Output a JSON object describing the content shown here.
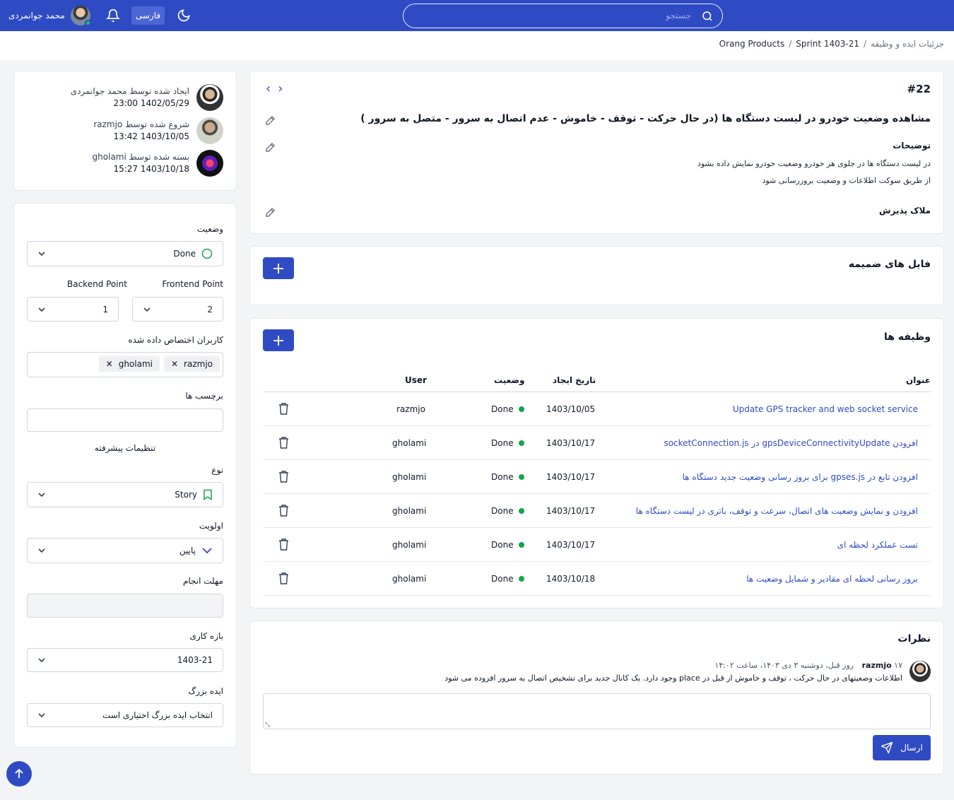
{
  "header": {
    "user_name": "محمد جوانمردی",
    "language_label": "فارسی",
    "search_placeholder": "جستجو"
  },
  "breadcrumb": {
    "items": [
      "Orang Products",
      "Sprint 1403-21",
      "جزئیات ایده و وظیفه"
    ]
  },
  "activity": [
    {
      "label": "ایجاد شده توسط محمد جوانمردی",
      "date": "23:00 1402/05/29"
    },
    {
      "label": "شروع شده توسط razmjo",
      "date": "13:42 1403/10/05"
    },
    {
      "label": "بسته شده توسط gholami",
      "date": "15:27 1403/10/18"
    }
  ],
  "form": {
    "status_label": "وضعیت",
    "status_value": "Done",
    "frontend_label": "Frontend Point",
    "frontend_value": "2",
    "backend_label": "Backend Point",
    "backend_value": "1",
    "assignees_label": "کاربران اختصاص داده شده",
    "assignees": [
      "razmjo",
      "gholami"
    ],
    "tags_label": "برچسب ها",
    "advanced_label": "تنظیمات پیشرفته",
    "type_label": "نوع",
    "type_value": "Story",
    "priority_label": "اولویت",
    "priority_value": "پایین",
    "deadline_label": "مهلت انجام",
    "sprint_label": "بازه کاری",
    "sprint_value": "1403-21",
    "epic_label": "ایده بزرگ",
    "epic_value": "انتخاب ایده بزرگ اختیاری است"
  },
  "task": {
    "number": "#22",
    "title": "مشاهده وضعیت خودرو در لیست دستگاه ها (در حال حرکت - توقف - خاموش - عدم اتصال به سرور - متصل به سرور )",
    "description_label": "توضیحات",
    "description_lines": [
      "در لیست دستگاه ها در جلوی هر خودرو  وضعیت خودرو نمایش داده بشود",
      "از طریق سوکت اطلاعات و وضعیت بروزرسانی شود"
    ],
    "acceptance_label": "ملاک پذیرش"
  },
  "attachments": {
    "title": "فایل های ضمیمه"
  },
  "subtasks": {
    "title": "وظیفه ها",
    "columns": {
      "title": "عنوان",
      "created": "تاریخ ایجاد",
      "status": "وضعیت",
      "user": "User"
    },
    "rows": [
      {
        "title": "Update GPS tracker and web socket service",
        "created": "1403/10/05",
        "status": "Done",
        "user": "razmjo"
      },
      {
        "title": "افزودن gpsDeviceConnectivityUpdate در socketConnection.js",
        "created": "1403/10/17",
        "status": "Done",
        "user": "gholami"
      },
      {
        "title": "افزودن تابع در gpses.js برای بروز رسانی وضعیت جدید دستگاه ها",
        "created": "1403/10/17",
        "status": "Done",
        "user": "gholami"
      },
      {
        "title": "افزودن و نمایش وضعیت های اتصال، سرعت و توقف، باتری در لیست دستگاه ها",
        "created": "1403/10/17",
        "status": "Done",
        "user": "gholami"
      },
      {
        "title": "تست عملکرد لحظه ای",
        "created": "1403/10/17",
        "status": "Done",
        "user": "gholami"
      },
      {
        "title": "بروز رسانی لحظه ای مقادیر و شمایل وضعیت ها",
        "created": "1403/10/18",
        "status": "Done",
        "user": "gholami"
      }
    ]
  },
  "comments": {
    "title": "نظرات",
    "items": [
      {
        "user": "razmjo",
        "meta": "۱۷ روز قبل، دوشنبه ۳ دی ۱۴۰۳، ساعت ۱۴:۰۲",
        "text": "اطلاعات وضعیتهای در حال حرکت ، توقف و خاموش از قبل در place وجود دارد. یک کانال جدید برای تشخیص اتصال به سرور افزوده می شود"
      }
    ],
    "send_label": "ارسال"
  },
  "colors": {
    "primary": "#2f4bc4",
    "success": "#16a34a",
    "link": "#2f4bc4"
  }
}
